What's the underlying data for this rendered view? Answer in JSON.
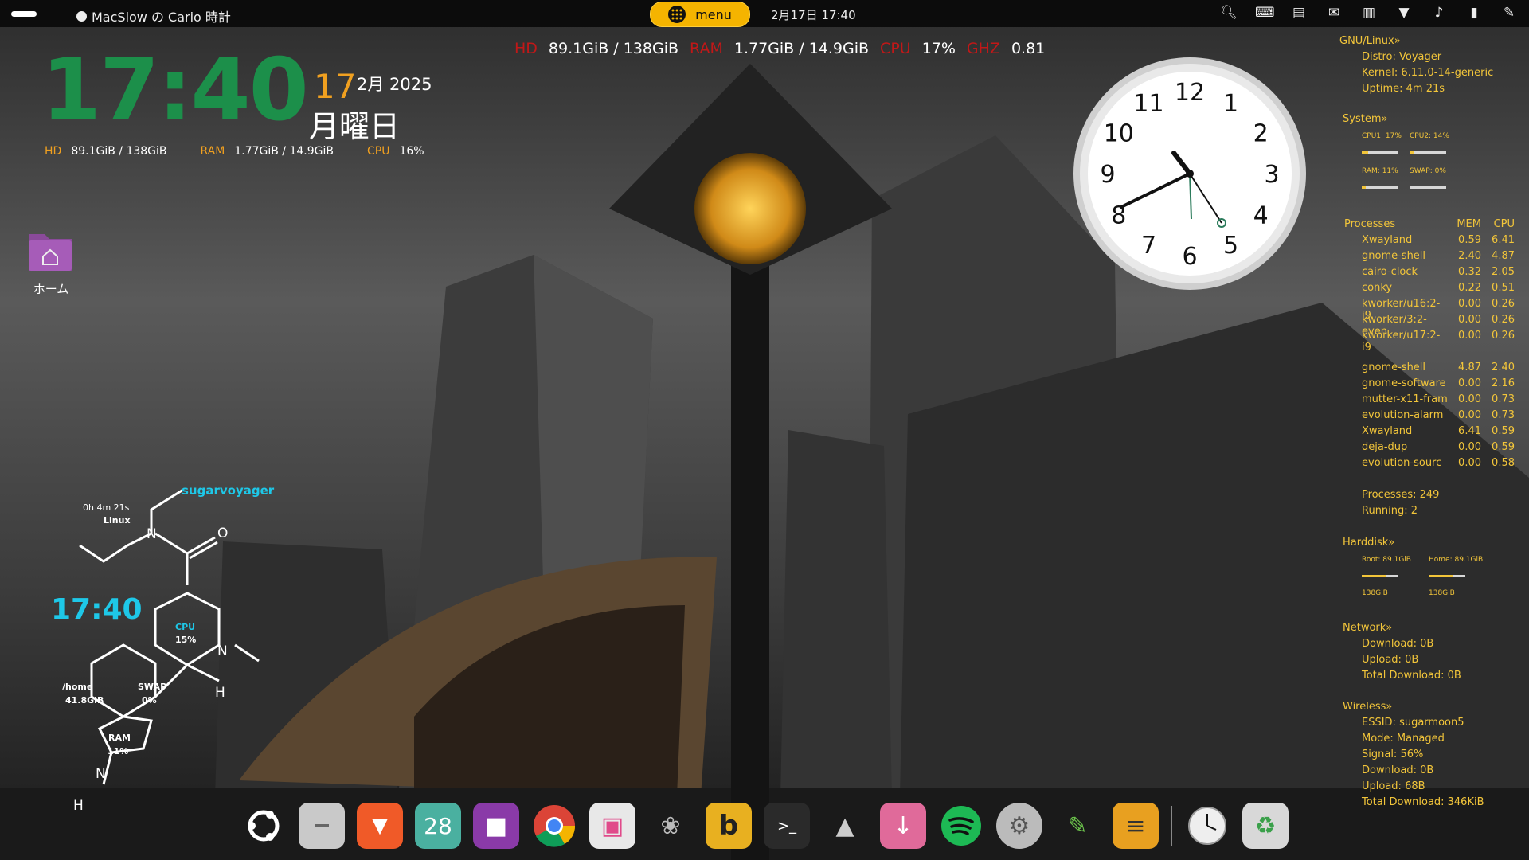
{
  "topbar": {
    "app_name": "MacSlow の Cario 時計",
    "menu_label": "menu",
    "datetime": "2月17日  17:40",
    "tray_icons": [
      "search-icon",
      "keyboard-icon",
      "drive-icon",
      "mail-icon",
      "clipboard-icon",
      "wifi-icon",
      "volume-icon",
      "battery-icon",
      "pen-icon"
    ]
  },
  "conky_top": {
    "hd_label": "HD",
    "hd_value": "89.1GiB / 138GiB",
    "ram_label": "RAM",
    "ram_value": "1.77GiB / 14.9GiB",
    "cpu_label": "CPU",
    "cpu_value": "17%",
    "ghz_label": "GHZ",
    "ghz_value": "0.81"
  },
  "big_clock": {
    "time": "17:40",
    "day": "17",
    "month_year": "2月 2025",
    "weekday": "月曜日",
    "hd_label": "HD",
    "hd_value": "89.1GiB / 138GiB",
    "ram_label": "RAM",
    "ram_value": "1.77GiB / 14.9GiB",
    "cpu_label": "CPU",
    "cpu_value": "16%"
  },
  "desktop": {
    "home_label": "ホーム"
  },
  "analog_clock": {
    "numbers": [
      "12",
      "1",
      "2",
      "3",
      "4",
      "5",
      "6",
      "7",
      "8",
      "9",
      "10",
      "11"
    ]
  },
  "sysinfo": {
    "gnu_header": "GNU/Linux»",
    "distro": "Distro: Voyager",
    "kernel": "Kernel: 6.11.0-14-generic",
    "uptime": "Uptime: 4m 21s",
    "system_header": "System»",
    "cpu1": "CPU1: 17%",
    "cpu2": "CPU2: 14%",
    "ram": "RAM: 11%",
    "swap": "SWAP: 0%",
    "cpu1_level": 0.17,
    "cpu2_level": 0.14,
    "ram_level": 0.11,
    "swap_level": 0.0,
    "processes_header": "Processes",
    "mem_header": "MEM",
    "cpu_header": "CPU",
    "top_cpu": [
      {
        "name": "Xwayland",
        "mem": "0.59",
        "cpu": "6.41"
      },
      {
        "name": "gnome-shell",
        "mem": "2.40",
        "cpu": "4.87"
      },
      {
        "name": "cairo-clock",
        "mem": "0.32",
        "cpu": "2.05"
      },
      {
        "name": "conky",
        "mem": "0.22",
        "cpu": "0.51"
      },
      {
        "name": "kworker/u16:2-i9",
        "mem": "0.00",
        "cpu": "0.26"
      },
      {
        "name": "kworker/3:2-even",
        "mem": "0.00",
        "cpu": "0.26"
      },
      {
        "name": "kworker/u17:2-i9",
        "mem": "0.00",
        "cpu": "0.26"
      }
    ],
    "top_mem": [
      {
        "name": "gnome-shell",
        "mem": "4.87",
        "cpu": "2.40"
      },
      {
        "name": "gnome-software",
        "mem": "0.00",
        "cpu": "2.16"
      },
      {
        "name": "mutter-x11-fram",
        "mem": "0.00",
        "cpu": "0.73"
      },
      {
        "name": "evolution-alarm",
        "mem": "0.00",
        "cpu": "0.73"
      },
      {
        "name": "Xwayland",
        "mem": "6.41",
        "cpu": "0.59"
      },
      {
        "name": "deja-dup",
        "mem": "0.00",
        "cpu": "0.59"
      },
      {
        "name": "evolution-sourc",
        "mem": "0.00",
        "cpu": "0.58"
      }
    ],
    "processes": "Processes: 249",
    "running": "Running: 2",
    "harddisk_header": "Harddisk»",
    "root": "Root: 89.1GiB",
    "home": "Home: 89.1GiB",
    "root_total": "138GiB",
    "home_total": "138GiB",
    "root_level": 0.65,
    "home_level": 0.65,
    "network_header": "Network»",
    "download": "Download: 0B",
    "upload": "Upload: 0B",
    "total_download": "Total Download: 0B",
    "wireless_header": "Wireless»",
    "essid": "ESSID: sugarmoon5",
    "mode": "Mode: Managed",
    "signal": "Signal: 56%",
    "w_download": "Download: 0B",
    "w_upload": "Upload: 68B",
    "w_total_download": "Total Download: 346KiB"
  },
  "molecule": {
    "user": "sugarvoyager",
    "uptime": "0h 4m 21s",
    "os": "Linux",
    "time": "17:40",
    "cpu_label": "CPU",
    "cpu_value": "15%",
    "home_label": "/home",
    "home_value": "41.8GiB",
    "swap_label": "SWAP",
    "swap_value": "0%",
    "ram_label": "RAM",
    "ram_value": "11%",
    "atom_n": "N",
    "atom_o": "O",
    "atom_h": "H"
  },
  "dock": {
    "apps": [
      "ubuntu-icon",
      "files-icon",
      "brave-icon",
      "calendar-icon",
      "video-icon",
      "chrome-icon",
      "photos-icon",
      "gimp-icon",
      "bluefish-icon",
      "terminal-icon",
      "inkscape-icon",
      "archive-icon",
      "spotify-icon",
      "settings-icon",
      "editor-icon",
      "notes-icon",
      "clock-icon",
      "trash-icon"
    ],
    "calendar_day": "28",
    "terminal_prompt": ">_"
  }
}
